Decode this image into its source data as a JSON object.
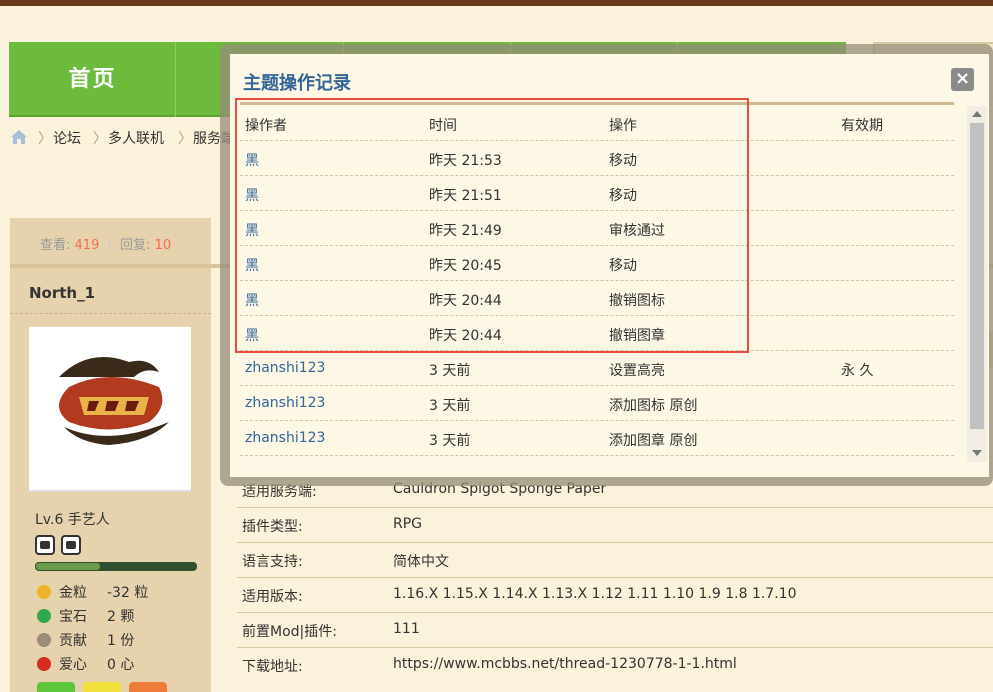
{
  "nav": {
    "home_label": "首页"
  },
  "breadcrumb": {
    "items": [
      "论坛",
      "多人联机",
      "服务端"
    ]
  },
  "stats": {
    "views_label": "查看:",
    "views": "419",
    "replies_label": "回复:",
    "replies": "10"
  },
  "author": {
    "name": "North_1",
    "level": "Lv.6 手艺人",
    "level_progress": 0.4,
    "attributes": [
      {
        "icon": "gold-icon",
        "label": "金粒",
        "value": "-32 粒",
        "color": "#f0b429"
      },
      {
        "icon": "gem-icon",
        "label": "宝石",
        "value": "2 颗",
        "color": "#2fa84f"
      },
      {
        "icon": "contribution-icon",
        "label": "贡献",
        "value": "1 份",
        "color": "#9b8c7a"
      },
      {
        "icon": "heart-icon",
        "label": "爱心",
        "value": "0 心",
        "color": "#d62d20"
      }
    ]
  },
  "info": [
    {
      "label": "适用服务端:",
      "value": "Cauldron Spigot Sponge Paper"
    },
    {
      "label": "插件类型:",
      "value": "RPG"
    },
    {
      "label": "语言支持:",
      "value": "简体中文"
    },
    {
      "label": "适用版本:",
      "value": "1.16.X 1.15.X 1.14.X 1.13.X 1.12 1.11 1.10 1.9 1.8 1.7.10"
    },
    {
      "label": "前置Mod|插件:",
      "value": "111"
    },
    {
      "label": "下载地址:",
      "value": "https://www.mcbbs.net/thread-1230778-1-1.html"
    }
  ],
  "modal": {
    "title": "主题操作记录",
    "close": "×",
    "headers": [
      "操作者",
      "时间",
      "操作",
      "有效期"
    ],
    "rows": [
      [
        "黑",
        "昨天 21:53",
        "移动",
        ""
      ],
      [
        "黑",
        "昨天 21:51",
        "移动",
        ""
      ],
      [
        "黑",
        "昨天 21:49",
        "审核通过",
        ""
      ],
      [
        "黑",
        "昨天 20:45",
        "移动",
        ""
      ],
      [
        "黑",
        "昨天 20:44",
        "撤销图标",
        ""
      ],
      [
        "黑",
        "昨天 20:44",
        "撤销图章",
        ""
      ],
      [
        "zhanshi123",
        "3 天前",
        "设置高亮",
        "永 久"
      ],
      [
        "zhanshi123",
        "3 天前",
        "添加图标 原创",
        ""
      ],
      [
        "zhanshi123",
        "3 天前",
        "添加图章 原创",
        ""
      ]
    ]
  },
  "colors": {
    "nav_green": "#6cbb3c",
    "link_blue": "#336699",
    "highlight_red": "#e74c3c",
    "stat_orange": "#f26c4f"
  }
}
